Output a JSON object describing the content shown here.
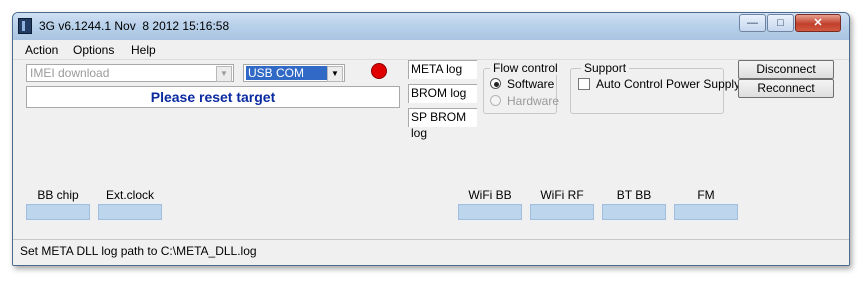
{
  "window": {
    "title": "3G v6.1244.1 Nov  8 2012 15:16:58"
  },
  "caption_buttons": {
    "minimize": "—",
    "maximize": "□",
    "close": "✕"
  },
  "menu": {
    "items": [
      "Action",
      "Options",
      "Help"
    ]
  },
  "controls": {
    "imei_select": "IMEI download",
    "port_select": "USB COM",
    "message": "Please reset target",
    "indicator_color": "#e00000"
  },
  "logs": {
    "meta": "META log",
    "brom": "BROM log",
    "sp_brom": "SP BROM log"
  },
  "flow_control": {
    "title": "Flow control",
    "software": "Software",
    "hardware": "Hardware",
    "selected": "Software"
  },
  "support": {
    "title": "Support",
    "auto_power": "Auto Control Power Supply"
  },
  "buttons": {
    "disconnect": "Disconnect",
    "reconnect": "Reconnect"
  },
  "info_left": {
    "bb_chip": "BB chip",
    "ext_clock": "Ext.clock"
  },
  "info_right": {
    "wifi_bb": "WiFi BB",
    "wifi_rf": "WiFi RF",
    "bt_bb": "BT BB",
    "fm": "FM"
  },
  "status": {
    "text": "Set META DLL log path to C:\\META_DLL.log"
  }
}
